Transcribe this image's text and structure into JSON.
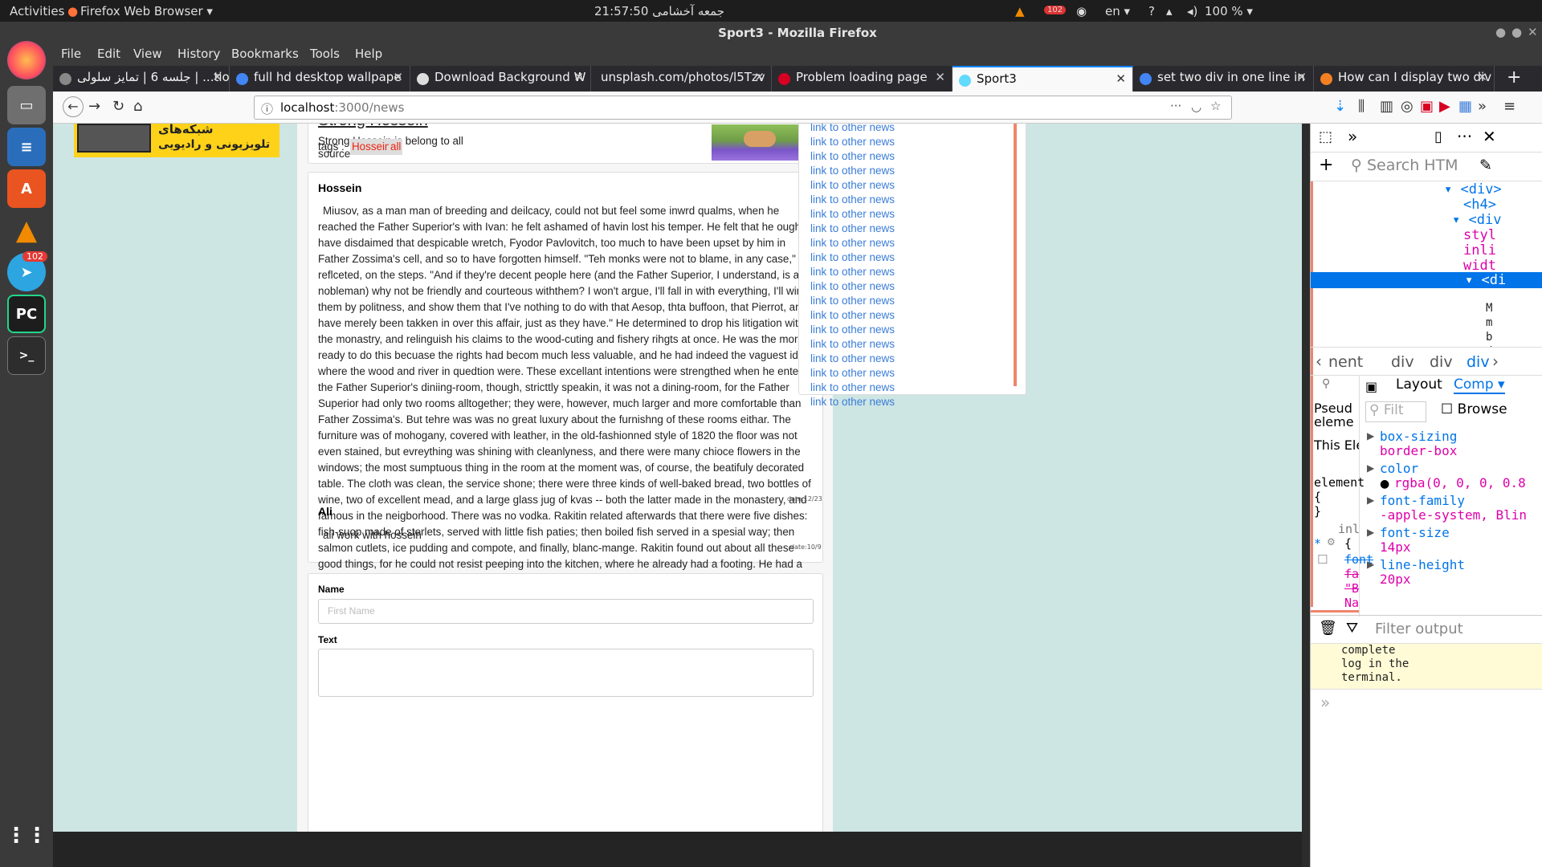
{
  "topbar": {
    "activities": "Activities",
    "app": "Firefox Web Browser ▾",
    "clock": "21:57:50 جمعه آخشامی",
    "lang": "en ▾",
    "battery": "100 % ▾",
    "badge": "102"
  },
  "dock": {
    "telegram_badge": "102"
  },
  "window": {
    "title": "Sport3 - Mozilla Firefox"
  },
  "menu": [
    "File",
    "Edit",
    "View",
    "History",
    "Bookmarks",
    "Tools",
    "Help"
  ],
  "tabs": [
    {
      "label": "جلسه 6 | تمایز سلولی | ...tion"
    },
    {
      "label": "full hd desktop wallpape"
    },
    {
      "label": "Download Background W"
    },
    {
      "label": "unsplash.com/photos/l5Tzv"
    },
    {
      "label": "Problem loading page"
    },
    {
      "label": "Sport3"
    },
    {
      "label": "set two div in one line in"
    },
    {
      "label": "How can I display two div"
    }
  ],
  "url": {
    "host": "localhost",
    "rest": ":3000/news"
  },
  "page": {
    "ad_text1": "شبکه‌های",
    "ad_text2": "تلویزیونی و رادیویی",
    "post_title": "Strong Hossein",
    "post_desc": "Strong Hossein is belong to all",
    "post_source": "source",
    "tags_label": "tags  :",
    "tags": [
      "Hossein",
      "all"
    ],
    "comments": [
      {
        "author": "Hossein",
        "text": "Miusov, as a man man of breeding and deilcacy, could not but feel some inwrd qualms, when he reached the Father Superior's with Ivan: he felt ashamed of havin lost his temper. He felt that he ought to have disdaimed that despicable wretch, Fyodor Pavlovitch, too much to have been upset by him in Father Zossima's cell, and so to have forgotten himself. \"Teh monks were not to blame, in any case,\" he reflceted, on the steps. \"And if they're decent people here (and the Father Superior, I understand, is a nobleman) why not be friendly and courteous withthem? I won't argue, I'll fall in with everything, I'll win them by politness, and show them that I've nothing to do with that Aesop, thta buffoon, that Pierrot, and have merely been takken in over this affair, just as they have.\" He determined to drop his litigation with the monastry, and relinguish his claims to the wood-cuting and fishery rihgts at once. He was the more ready to do this becuase the rights had becom much less valuable, and he had indeed the vaguest idea where the wood and river in quedtion were. These excellant intentions were strengthed when he enterd the Father Superior's diniing-room, though, stricttly speakin, it was not a dining-room, for the Father Superior had only two rooms alltogether; they were, however, much larger and more comfortable than Father Zossima's. But tehre was was no great luxury about the furnishng of these rooms eithar. The furniture was of mohogany, covered with leather, in the old-fashionned style of 1820 the floor was not even stained, but evreything was shining with cleanlyness, and there were many chioce flowers in the windows; the most sumptuous thing in the room at the moment was, of course, the beatifuly decorated table. The cloth was clean, the service shone; there were three kinds of well-baked bread, two bottles of wine, two of excellent mead, and a large glass jug of kvas -- both the latter made in the monastery, and famous in the neigborhood. There was no vodka. Rakitin related afterwards that there were five dishes: fish-suop made of sterlets, served with little fish paties; then boiled fish served in a spesial way; then salmon cutlets, ice pudding and compote, and finally, blanc-mange. Rakitin found out about all these good things, for he could not resist peeping into the kitchen, where he already had a footing. He had a footting everywhere, and got informaiton about everything. He was of an uneasy and envious temper. He was well",
        "date": "date:12/23"
      },
      {
        "author": "Ali",
        "text": "ali work with hossein",
        "date": "date:10/9"
      }
    ],
    "form": {
      "name_label": "Name",
      "name_placeholder": "First Name",
      "text_label": "Text"
    },
    "sidebar_link": "link to other news",
    "sidebar_count": 20
  },
  "devtools": {
    "search_placeholder": "Search HTM",
    "tree": [
      "<div>",
      "<h4>",
      "<div",
      "styl",
      "inli",
      "widt",
      "<di",
      "M",
      "m",
      "b",
      "d"
    ],
    "breadcrumb": [
      "nent",
      "div",
      "div",
      "div"
    ],
    "tabs": {
      "layout": "Layout",
      "computed": "Comp"
    },
    "filter_placeholder": "Filt",
    "browser_styles": "Browse",
    "pseudo": "Pseud eleme",
    "this_element": "This Elem",
    "element_rule": "element",
    "brace_open": "{",
    "brace_close": "}",
    "inline": "inl",
    "star": "*",
    "struck": [
      "font",
      "fa",
      "\"B",
      "Na"
    ],
    "computed": [
      {
        "prop": "box-sizing",
        "val": "border-box"
      },
      {
        "prop": "color",
        "val": "rgba(0, 0, 0, 0.8"
      },
      {
        "prop": "font-family",
        "val": "-apple-system, Blin"
      },
      {
        "prop": "font-size",
        "val": "14px"
      },
      {
        "prop": "line-height",
        "val": "20px"
      }
    ],
    "filter_output": "Filter output",
    "console_msg": "complete\nlog in the\nterminal.",
    "prompt": "»"
  }
}
